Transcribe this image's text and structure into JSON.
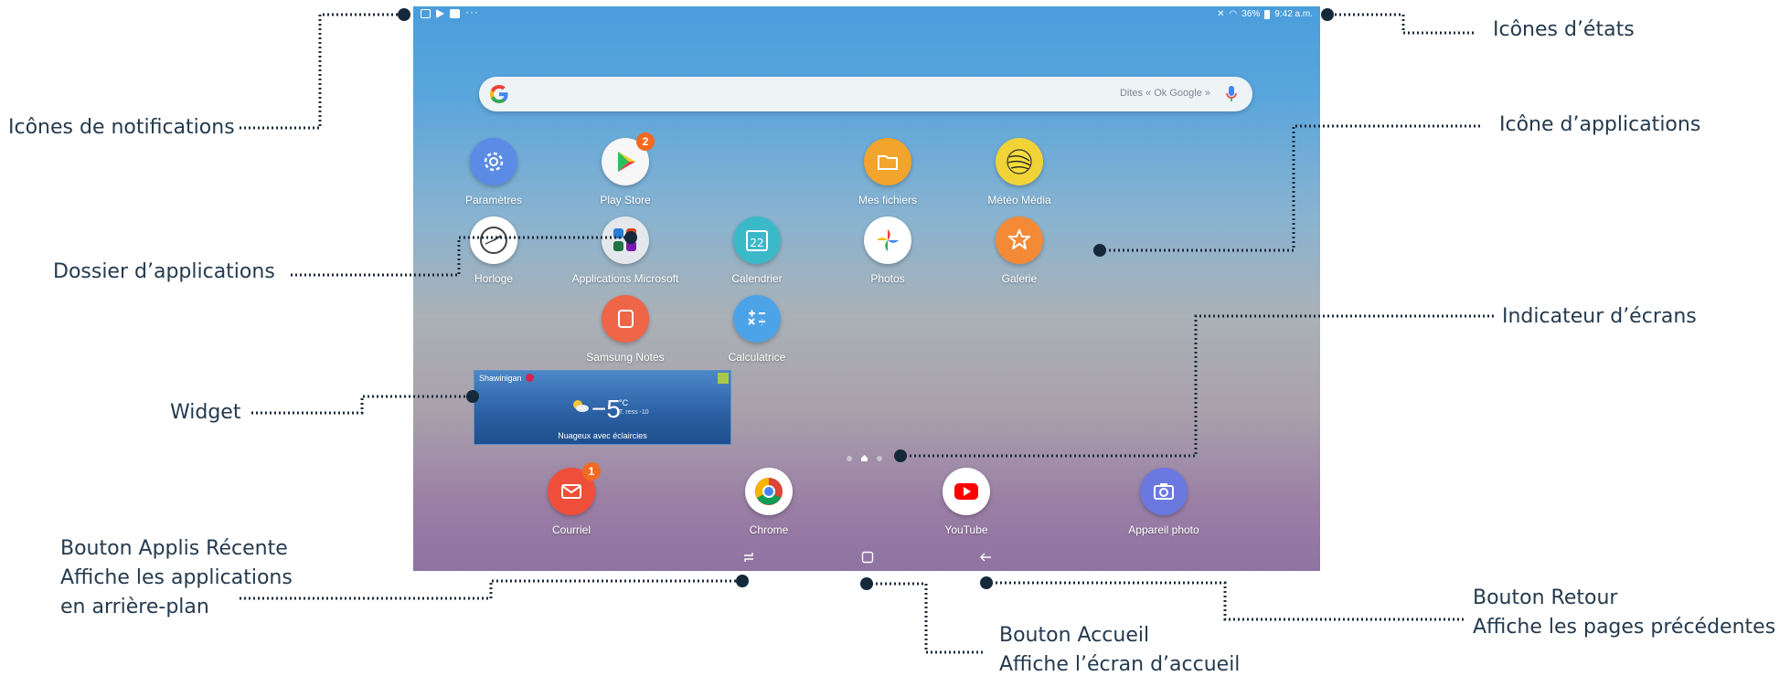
{
  "status_bar": {
    "notification_icons": [
      "image-icon",
      "play-icon",
      "mail-icon",
      "more-icon"
    ],
    "more_glyph": "···",
    "right_text": "36% ▮ 9:42 a.m.",
    "battery": "36%",
    "time": "9:42 a.m."
  },
  "search": {
    "placeholder": "Dites « Ok Google »",
    "logo": "G"
  },
  "apps": {
    "parametres": "Paramètres",
    "play_store": "Play Store",
    "play_store_badge": "2",
    "mes_fichiers": "Mes fichiers",
    "meteo_media": "Météo Média",
    "horloge": "Horloge",
    "applications_microsoft": "Applications Microsoft",
    "calendrier": "Calendrier",
    "calendrier_day": "22",
    "photos": "Photos",
    "galerie": "Galerie",
    "samsung_notes": "Samsung Notes",
    "calculatrice": "Calculatrice"
  },
  "widget": {
    "city": "Shawinigan",
    "temperature": "−5",
    "unit": "°C",
    "feels_like": "T. ress -10",
    "condition": "Nuageux avec éclaircies"
  },
  "dock": {
    "courriel": "Courriel",
    "courriel_badge": "1",
    "chrome": "Chrome",
    "youtube": "YouTube",
    "appareil_photo": "Appareil photo"
  },
  "annotations": {
    "icones_notifications": "Icônes de notifications",
    "icones_etats": "Icônes d’états",
    "icone_applications": "Icône d’applications",
    "dossier_applications": "Dossier d’applications",
    "indicateur_ecrans": "Indicateur d’écrans",
    "widget": "Widget",
    "bouton_applis_line1": "Bouton Applis Récente",
    "bouton_applis_line2": "Affiche les applications",
    "bouton_applis_line3": "en arrière-plan",
    "bouton_accueil_line1": "Bouton Accueil",
    "bouton_accueil_line2": "Affiche l’écran d’accueil",
    "bouton_retour_line1": "Bouton Retour",
    "bouton_retour_line2": "Affiche les pages précédentes"
  },
  "colors": {
    "annotation_text": "#243a4e",
    "leader_line": "#1b2a3a",
    "badge": "#f26a21"
  }
}
